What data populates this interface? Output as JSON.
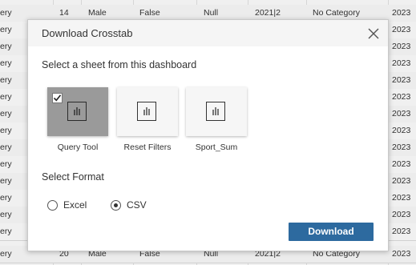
{
  "background_table": {
    "rows": [
      {
        "left": "ery",
        "num": "14",
        "gender": "Male",
        "bool": "False",
        "null": "Null",
        "period": "2021|2",
        "category": "No Category",
        "year": "2023"
      },
      {
        "left": "ery",
        "year": "2023"
      },
      {
        "left": "ery",
        "year": "2023"
      },
      {
        "left": "ery",
        "year": "2023"
      },
      {
        "left": "ery",
        "year": "2023"
      },
      {
        "left": "ery",
        "year": "2023"
      },
      {
        "left": "ery",
        "year": "2023"
      },
      {
        "left": "ery",
        "year": "2023"
      },
      {
        "left": "ery",
        "year": "2023"
      },
      {
        "left": "ery",
        "year": "2023"
      },
      {
        "left": "ery",
        "year": "2023"
      },
      {
        "left": "ery",
        "year": "2023"
      },
      {
        "left": "ery",
        "year": "2023"
      },
      {
        "left": "ery",
        "year": "2023"
      },
      {
        "left": "ery",
        "num": "20",
        "gender": "Male",
        "bool": "False",
        "null": "Null",
        "period": "2021|2",
        "category": "No Category",
        "year": "2023"
      }
    ]
  },
  "dialog": {
    "title": "Download Crosstab",
    "close_icon": "close-x-icon",
    "sheet_section_label": "Select a sheet from this dashboard",
    "sheets": [
      {
        "name": "Query Tool",
        "selected": true,
        "icon": "bar-chart-icon"
      },
      {
        "name": "Reset Filters",
        "selected": false,
        "icon": "bar-chart-icon"
      },
      {
        "name": "Sport_Sum",
        "selected": false,
        "icon": "bar-chart-icon"
      }
    ],
    "format_section_label": "Select Format",
    "formats": [
      {
        "label": "Excel",
        "selected": false
      },
      {
        "label": "CSV",
        "selected": true
      }
    ],
    "download_label": "Download",
    "colors": {
      "accent": "#2d6a9f",
      "selected_tile": "#9a9a9a",
      "header_bg": "#f5f5f5"
    }
  }
}
